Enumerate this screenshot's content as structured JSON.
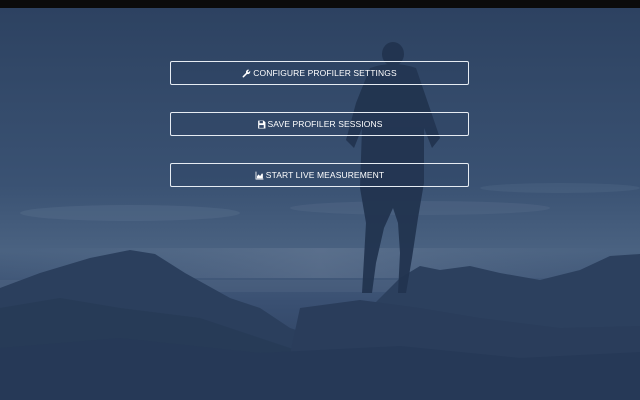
{
  "background": {
    "overlay_color": "#33496b",
    "image_icon": "silhouette-on-rocks-at-dusk"
  },
  "menu": {
    "buttons": [
      {
        "label": "CONFIGURE PROFILER SETTINGS",
        "icon": "wrench-icon"
      },
      {
        "label": "SAVE PROFILER SESSIONS",
        "icon": "floppy-disk-icon"
      },
      {
        "label": "START LIVE MEASUREMENT",
        "icon": "area-chart-icon"
      }
    ]
  },
  "colors": {
    "button_border": "#e6ecf3",
    "button_text": "#ffffff",
    "top_bar": "#0b0b0b"
  }
}
